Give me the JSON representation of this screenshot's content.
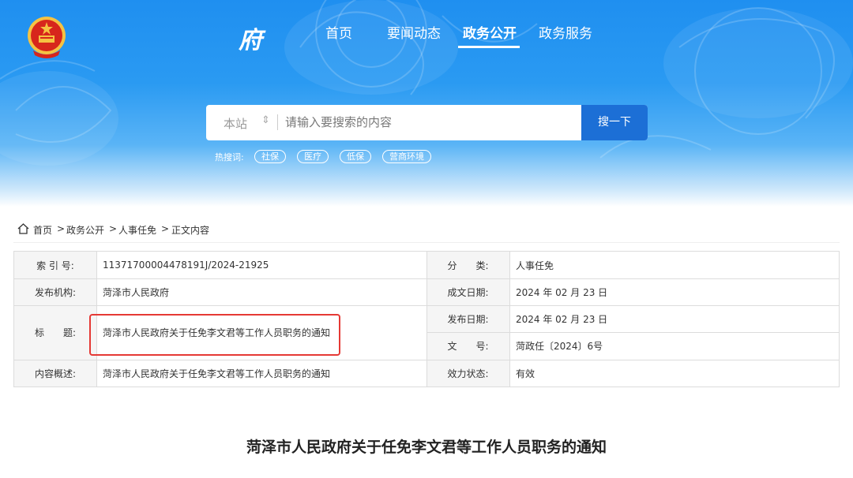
{
  "header": {
    "logo_text": "府",
    "nav": [
      {
        "label": "首页",
        "active": false
      },
      {
        "label": "要闻动态",
        "active": false
      },
      {
        "label": "政务公开",
        "active": true
      },
      {
        "label": "政务服务",
        "active": false
      }
    ]
  },
  "search": {
    "scope": "本站",
    "placeholder": "请输入要搜索的内容",
    "button": "搜一下"
  },
  "hot": {
    "label": "热搜词:",
    "tags": [
      "社保",
      "医疗",
      "低保",
      "营商环境"
    ]
  },
  "breadcrumb": [
    "首页",
    ">",
    "政务公开",
    ">",
    "人事任免",
    ">",
    "正文内容"
  ],
  "info": {
    "index_label": "索 引 号:",
    "index_value": "11371700004478191J/2024-21925",
    "category_label": "分　　类:",
    "category_value": "人事任免",
    "publisher_label": "发布机构:",
    "publisher_value": "菏泽市人民政府",
    "created_label": "成文日期:",
    "created_value": "2024 年 02 月 23 日",
    "title_label": "标　　题:",
    "title_value": "菏泽市人民政府关于任免李文君等工作人员职务的通知",
    "published_label": "发布日期:",
    "published_value": "2024 年 02 月 23 日",
    "doc_no_label": "文　　号:",
    "doc_no_value": "菏政任〔2024〕6号",
    "summary_label": "内容概述:",
    "summary_value": "菏泽市人民政府关于任免李文君等工作人员职务的通知",
    "status_label": "效力状态:",
    "status_value": "有效"
  },
  "article": {
    "title": "菏泽市人民政府关于任免李文君等工作人员职务的通知"
  },
  "colors": {
    "banner_blue": "#1f8ff0",
    "search_button": "#1c6fd6",
    "highlight_red": "#e53935",
    "emblem_red": "#d7261c",
    "emblem_gold": "#f5c242"
  }
}
